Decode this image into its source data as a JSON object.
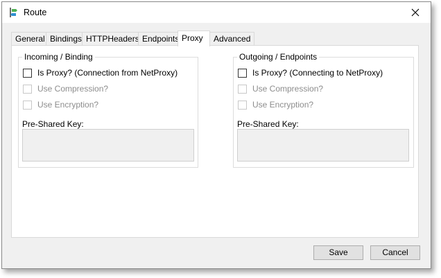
{
  "window": {
    "title": "Route"
  },
  "tabs": [
    "General",
    "Bindings",
    "HTTPHeaders",
    "Endpoints",
    "Proxy",
    "Advanced"
  ],
  "active_tab": "Proxy",
  "incoming": {
    "group_title": "Incoming / Binding",
    "is_proxy_label": "Is Proxy? (Connection from NetProxy)",
    "use_compression_label": "Use Compression?",
    "use_encryption_label": "Use Encryption?",
    "psk_label": "Pre-Shared Key:",
    "psk_value": ""
  },
  "outgoing": {
    "group_title": "Outgoing / Endpoints",
    "is_proxy_label": "Is Proxy? (Connecting to NetProxy)",
    "use_compression_label": "Use Compression?",
    "use_encryption_label": "Use Encryption?",
    "psk_label": "Pre-Shared Key:",
    "psk_value": ""
  },
  "buttons": {
    "save": "Save",
    "cancel": "Cancel"
  }
}
